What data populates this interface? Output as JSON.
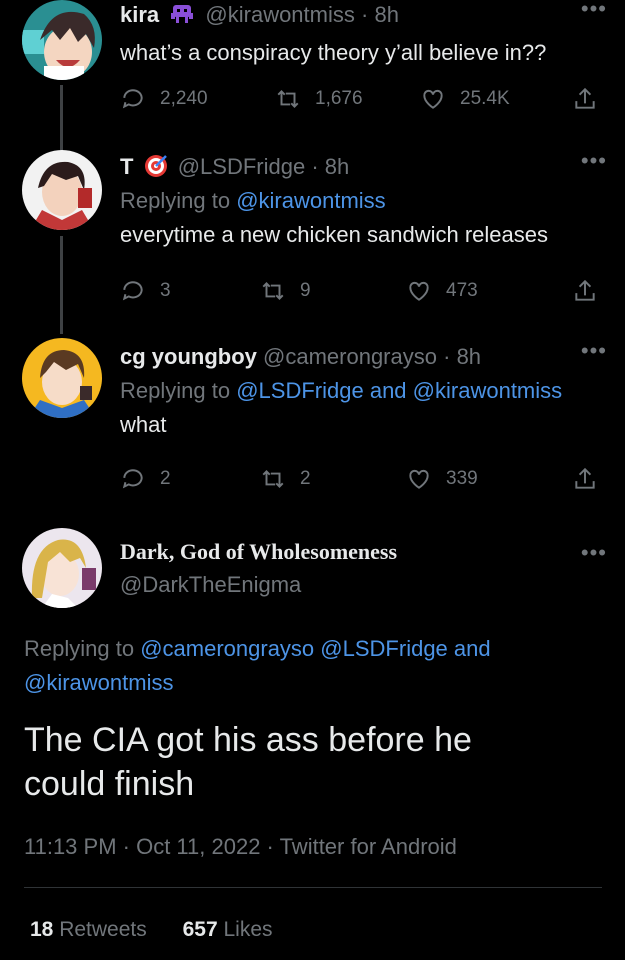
{
  "tweets": [
    {
      "name": "kira",
      "handle": "@kirawontmiss",
      "time": "8h",
      "reply_label": "",
      "reply_to": [],
      "text": "what’s a conspiracy theory y’all believe in??",
      "replies": "2,240",
      "retweets": "1,676",
      "likes": "25.4K"
    },
    {
      "name": "T",
      "handle": "@LSDFridge",
      "time": "8h",
      "reply_label": "Replying to",
      "reply_to": [
        "@kirawontmiss"
      ],
      "text": "everytime a new chicken sandwich releases",
      "replies": "3",
      "retweets": "9",
      "likes": "473"
    },
    {
      "name": "cg youngboy",
      "handle": "@camerongrayso",
      "time": "8h",
      "reply_label": "Replying to",
      "reply_to": [
        "@LSDFridge",
        "and",
        "@kirawontmiss"
      ],
      "text": "what",
      "replies": "2",
      "retweets": "2",
      "likes": "339"
    }
  ],
  "main": {
    "name": "Dark, God of Wholesomeness",
    "handle": "@DarkTheEnigma",
    "reply_label": "Replying to",
    "reply_to_line1": [
      "@camerongrayso",
      "@LSDFridge",
      "and"
    ],
    "reply_to_line2": "@kirawontmiss",
    "text_line1": "The CIA got his ass before he",
    "text_line2": "could finish",
    "timestamp": "11:13 PM · Oct 11, 2022 · Twitter for Android",
    "retweet_count": "18",
    "retweet_label": "Retweets",
    "like_count": "657",
    "like_label": "Likes"
  },
  "sep": "·",
  "more_glyph": "•••",
  "colors": {
    "background": "#000000",
    "text": "#e7e9ea",
    "muted": "#71767b",
    "link": "#4d94e6",
    "line": "#3e4144"
  }
}
